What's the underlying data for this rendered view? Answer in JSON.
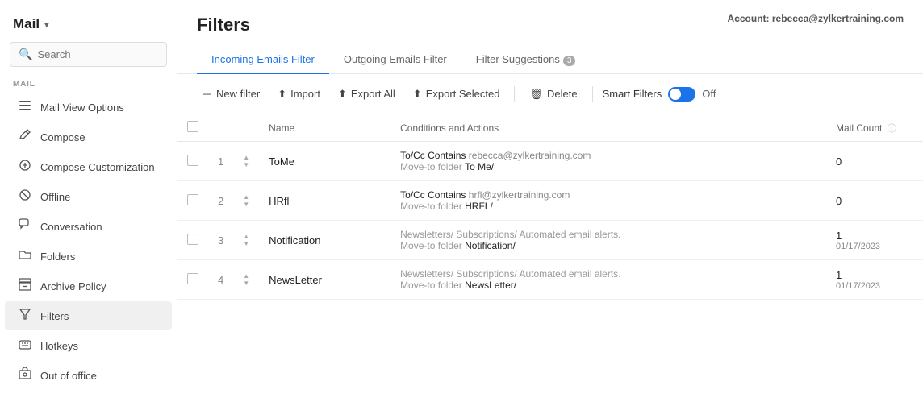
{
  "sidebar": {
    "brand": "Mail",
    "search_placeholder": "Search",
    "section_label": "MAIL",
    "items": [
      {
        "id": "mail-view-options",
        "label": "Mail View Options",
        "icon": "☰"
      },
      {
        "id": "compose",
        "label": "Compose",
        "icon": "✏️"
      },
      {
        "id": "compose-customization",
        "label": "Compose Customization",
        "icon": "✦"
      },
      {
        "id": "offline",
        "label": "Offline",
        "icon": "⊘"
      },
      {
        "id": "conversation",
        "label": "Conversation",
        "icon": "💬"
      },
      {
        "id": "folders",
        "label": "Folders",
        "icon": "📁"
      },
      {
        "id": "archive-policy",
        "label": "Archive Policy",
        "icon": "🗂"
      },
      {
        "id": "filters",
        "label": "Filters",
        "icon": "⚡",
        "active": true
      },
      {
        "id": "hotkeys",
        "label": "Hotkeys",
        "icon": "⌨"
      },
      {
        "id": "out-of-office",
        "label": "Out of office",
        "icon": "🌴"
      }
    ]
  },
  "header": {
    "title": "Filters",
    "account_label": "Account:",
    "account_email": "rebecca@zylkertraining.com"
  },
  "tabs": [
    {
      "id": "incoming",
      "label": "Incoming Emails Filter",
      "active": true
    },
    {
      "id": "outgoing",
      "label": "Outgoing Emails Filter",
      "active": false
    },
    {
      "id": "suggestions",
      "label": "Filter Suggestions",
      "badge": "3",
      "active": false
    }
  ],
  "toolbar": {
    "new_filter": "New filter",
    "import": "Import",
    "export_all": "Export All",
    "export_selected": "Export Selected",
    "delete": "Delete",
    "smart_filters": "Smart Filters",
    "off_label": "Off"
  },
  "table": {
    "columns": [
      {
        "id": "checkbox",
        "label": ""
      },
      {
        "id": "number",
        "label": ""
      },
      {
        "id": "sort",
        "label": ""
      },
      {
        "id": "name",
        "label": "Name"
      },
      {
        "id": "conditions",
        "label": "Conditions and Actions"
      },
      {
        "id": "mail_count",
        "label": "Mail Count"
      }
    ],
    "rows": [
      {
        "id": 1,
        "name": "ToMe",
        "condition_label": "To/Cc Contains",
        "condition_value": "rebecca@zylkertraining.com",
        "action_label": "Move-to folder",
        "action_value": "To Me/",
        "mail_count": "0",
        "mail_date": ""
      },
      {
        "id": 2,
        "name": "HRfl",
        "condition_label": "To/Cc Contains",
        "condition_value": "hrfl@zylkertraining.com",
        "action_label": "Move-to folder",
        "action_value": "HRFL/",
        "mail_count": "0",
        "mail_date": ""
      },
      {
        "id": 3,
        "name": "Notification",
        "condition_label": "Newsletters/ Subscriptions/ Automated email alerts.",
        "condition_value": "",
        "action_label": "Move-to folder",
        "action_value": "Notification/",
        "mail_count": "1",
        "mail_date": "01/17/2023"
      },
      {
        "id": 4,
        "name": "NewsLetter",
        "condition_label": "Newsletters/ Subscriptions/ Automated email alerts.",
        "condition_value": "",
        "action_label": "Move-to folder",
        "action_value": "NewsLetter/",
        "mail_count": "1",
        "mail_date": "01/17/2023"
      }
    ]
  }
}
